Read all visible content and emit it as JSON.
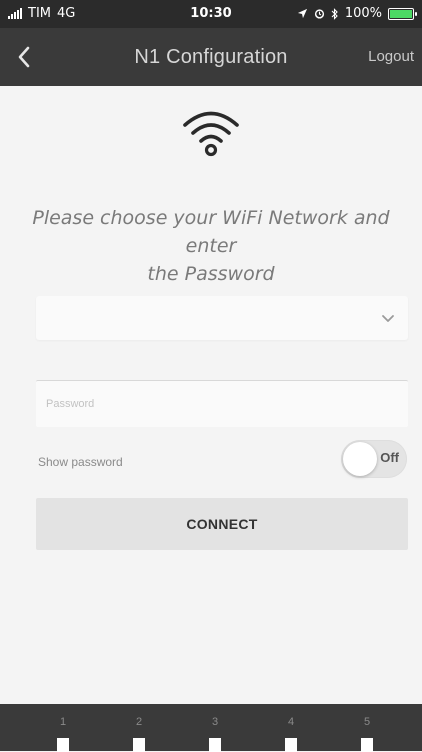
{
  "status_bar": {
    "carrier": "TIM",
    "network": "4G",
    "time": "10:30",
    "battery": "100%",
    "battery_fill": 1.0,
    "icons": [
      "location-icon",
      "alarm-icon",
      "bluetooth-icon"
    ]
  },
  "nav": {
    "back_icon": "chevron-left-icon",
    "title": "N1 Configuration",
    "logout_label": "Logout"
  },
  "main": {
    "wifi_icon": "wifi-icon",
    "instruction_line1": "Please choose your WiFi Network and enter",
    "instruction_line2": "the Password",
    "network_select": {
      "value": "",
      "icon": "chevron-down-icon"
    },
    "password": {
      "placeholder": "Password",
      "value": ""
    },
    "show_password": {
      "label": "Show password",
      "toggle_text": "Off",
      "state": false
    },
    "connect_label": "CONNECT"
  },
  "bottom_steps": [
    "1",
    "2",
    "3",
    "4",
    "5"
  ],
  "colors": {
    "nav_bg": "#3a3a3a",
    "content_bg": "#f4f4f4",
    "status_bar_bg": "#2b2b2b",
    "battery_green": "#4cd964"
  }
}
